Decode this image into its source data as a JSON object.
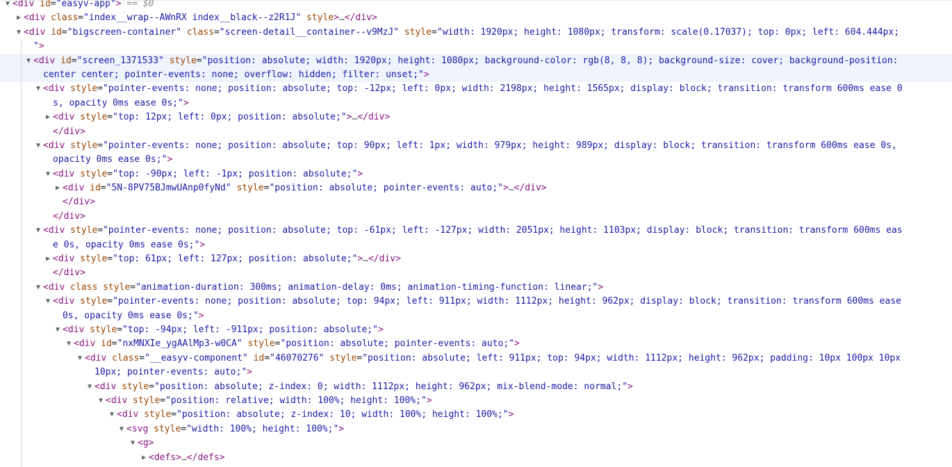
{
  "rows": [
    {
      "name": "row-easyv-app",
      "indent": 4,
      "tri": "▼",
      "html": "<span class='tag'>&lt;div</span> <span class='attr'>id</span><span class='punc'>=</span><span class='val'>\"easyv-app\"</span><span class='tag'>&gt;</span> <span class='eq0'>== $0</span>"
    },
    {
      "name": "row-index-wrap",
      "indent": 20,
      "tri": "▶",
      "html": "<span class='tag'>&lt;div</span> <span class='attr'>class</span><span class='punc'>=</span><span class='val'>\"index__wrap--AWnRX index__black--z2R1J\"</span> <span class='attr'>style</span><span class='tag'>&gt;</span><span class='ellipsis'>…</span><span class='tag'>&lt;/div&gt;</span>"
    },
    {
      "name": "row-bigscreen-container",
      "indent": 20,
      "tri": "▼",
      "html": "<span class='tag'>&lt;div</span> <span class='attr'>id</span><span class='punc'>=</span><span class='val'>\"bigscreen-container\"</span> <span class='attr'>class</span><span class='punc'>=</span><span class='val'>\"screen-detail__container--v9MzJ\"</span> <span class='attr'>style</span><span class='punc'>=</span><span class='val'>\"width: 1920px; height: 1080px; transform: scale(0.17037); top: 0px; left: 604.444px;</span>"
    },
    {
      "name": "row-bigscreen-container-cont",
      "indent": 34,
      "tri": "",
      "html": "<span class='val'>\"</span><span class='tag'>&gt;</span>"
    },
    {
      "name": "row-screen-1371533",
      "indent": 34,
      "tri": "▼",
      "selected": true,
      "html": "<span class='tag'>&lt;div</span> <span class='attr'>id</span><span class='punc'>=</span><span class='val'>\"screen_1371533\"</span> <span class='attr'>style</span><span class='punc'>=</span><span class='val'>\"position: absolute; width: 1920px; height: 1080px; background-color: rgb(8, 8, 8); background-size: cover; background-position:</span>"
    },
    {
      "name": "row-screen-1371533-cont",
      "indent": 48,
      "tri": "",
      "selected": true,
      "html": "<span class='val'>center center; pointer-events: none; overflow: hidden; filter: unset;\"</span><span class='tag'>&gt;</span>"
    },
    {
      "name": "row-layer-1",
      "indent": 48,
      "tri": "▼",
      "html": "<span class='tag'>&lt;div</span> <span class='attr'>style</span><span class='punc'>=</span><span class='val'>\"pointer-events: none; position: absolute; top: -12px; left: 0px; width: 2198px; height: 1565px; display: block; transition: transform 600ms ease 0</span>"
    },
    {
      "name": "row-layer-1-cont",
      "indent": 62,
      "tri": "",
      "html": "<span class='val'>s, opacity 0ms ease 0s;\"</span><span class='tag'>&gt;</span>"
    },
    {
      "name": "row-layer-1-inner",
      "indent": 62,
      "tri": "▶",
      "html": "<span class='tag'>&lt;div</span> <span class='attr'>style</span><span class='punc'>=</span><span class='val'>\"top: 12px; left: 0px; position: absolute;\"</span><span class='tag'>&gt;</span><span class='ellipsis'>…</span><span class='tag'>&lt;/div&gt;</span>"
    },
    {
      "name": "row-layer-1-close",
      "indent": 62,
      "tri": "",
      "html": "<span class='tag'>&lt;/div&gt;</span>"
    },
    {
      "name": "row-layer-2",
      "indent": 48,
      "tri": "▼",
      "html": "<span class='tag'>&lt;div</span> <span class='attr'>style</span><span class='punc'>=</span><span class='val'>\"pointer-events: none; position: absolute; top: 90px; left: 1px; width: 979px; height: 989px; display: block; transition: transform 600ms ease 0s,</span>"
    },
    {
      "name": "row-layer-2-cont",
      "indent": 62,
      "tri": "",
      "html": "<span class='val'>opacity 0ms ease 0s;\"</span><span class='tag'>&gt;</span>"
    },
    {
      "name": "row-layer-2-inner",
      "indent": 62,
      "tri": "▼",
      "html": "<span class='tag'>&lt;div</span> <span class='attr'>style</span><span class='punc'>=</span><span class='val'>\"top: -90px; left: -1px; position: absolute;\"</span><span class='tag'>&gt;</span>"
    },
    {
      "name": "row-layer-2-component",
      "indent": 76,
      "tri": "▶",
      "html": "<span class='tag'>&lt;div</span> <span class='attr'>id</span><span class='punc'>=</span><span class='val'>\"5N-8PV75BJmwUAnp0fyNd\"</span> <span class='attr'>style</span><span class='punc'>=</span><span class='val'>\"position: absolute; pointer-events: auto;\"</span><span class='tag'>&gt;</span><span class='ellipsis'>…</span><span class='tag'>&lt;/div&gt;</span>"
    },
    {
      "name": "row-layer-2-inner-close",
      "indent": 76,
      "tri": "",
      "html": "<span class='tag'>&lt;/div&gt;</span>"
    },
    {
      "name": "row-layer-2-close",
      "indent": 62,
      "tri": "",
      "html": "<span class='tag'>&lt;/div&gt;</span>"
    },
    {
      "name": "row-layer-3",
      "indent": 48,
      "tri": "▼",
      "html": "<span class='tag'>&lt;div</span> <span class='attr'>style</span><span class='punc'>=</span><span class='val'>\"pointer-events: none; position: absolute; top: -61px; left: -127px; width: 2051px; height: 1103px; display: block; transition: transform 600ms eas</span>"
    },
    {
      "name": "row-layer-3-cont",
      "indent": 62,
      "tri": "",
      "html": "<span class='val'>e 0s, opacity 0ms ease 0s;\"</span><span class='tag'>&gt;</span>"
    },
    {
      "name": "row-layer-3-inner",
      "indent": 62,
      "tri": "▶",
      "html": "<span class='tag'>&lt;div</span> <span class='attr'>style</span><span class='punc'>=</span><span class='val'>\"top: 61px; left: 127px; position: absolute;\"</span><span class='tag'>&gt;</span><span class='ellipsis'>…</span><span class='tag'>&lt;/div&gt;</span>"
    },
    {
      "name": "row-layer-3-close",
      "indent": 62,
      "tri": "",
      "html": "<span class='tag'>&lt;/div&gt;</span>"
    },
    {
      "name": "row-animation-div",
      "indent": 48,
      "tri": "▼",
      "html": "<span class='tag'>&lt;div</span> <span class='attr'>class</span> <span class='attr'>style</span><span class='punc'>=</span><span class='val'>\"animation-duration: 300ms; animation-delay: 0ms; animation-timing-function: linear;\"</span><span class='tag'>&gt;</span>"
    },
    {
      "name": "row-layer-4",
      "indent": 62,
      "tri": "▼",
      "html": "<span class='tag'>&lt;div</span> <span class='attr'>style</span><span class='punc'>=</span><span class='val'>\"pointer-events: none; position: absolute; top: 94px; left: 911px; width: 1112px; height: 962px; display: block; transition: transform 600ms ease</span>"
    },
    {
      "name": "row-layer-4-cont",
      "indent": 76,
      "tri": "",
      "html": "<span class='val'>0s, opacity 0ms ease 0s;\"</span><span class='tag'>&gt;</span>"
    },
    {
      "name": "row-layer-4-inner",
      "indent": 76,
      "tri": "▼",
      "html": "<span class='tag'>&lt;div</span> <span class='attr'>style</span><span class='punc'>=</span><span class='val'>\"top: -94px; left: -911px; position: absolute;\"</span><span class='tag'>&gt;</span>"
    },
    {
      "name": "row-layer-4-component",
      "indent": 92,
      "tri": "▼",
      "html": "<span class='tag'>&lt;div</span> <span class='attr'>id</span><span class='punc'>=</span><span class='val'>\"nxMNXIe_ygAAlMp3-w0CA\"</span> <span class='attr'>style</span><span class='punc'>=</span><span class='val'>\"position: absolute; pointer-events: auto;\"</span><span class='tag'>&gt;</span>"
    },
    {
      "name": "row-easyv-component",
      "indent": 108,
      "tri": "▼",
      "html": "<span class='tag'>&lt;div</span> <span class='attr'>class</span><span class='punc'>=</span><span class='val'>\"__easyv-component\"</span> <span class='attr'>id</span><span class='punc'>=</span><span class='val'>\"46070276\"</span> <span class='attr'>style</span><span class='punc'>=</span><span class='val'>\"position: absolute; left: 911px; top: 94px; width: 1112px; height: 962px; padding: 10px 100px 10px</span>"
    },
    {
      "name": "row-easyv-component-cont",
      "indent": 122,
      "tri": "",
      "html": "<span class='val'>10px; pointer-events: auto;\"</span><span class='tag'>&gt;</span>"
    },
    {
      "name": "row-blend-div",
      "indent": 122,
      "tri": "▼",
      "html": "<span class='tag'>&lt;div</span> <span class='attr'>style</span><span class='punc'>=</span><span class='val'>\"position: absolute; z-index: 0; width: 1112px; height: 962px; mix-blend-mode: normal;\"</span><span class='tag'>&gt;</span>"
    },
    {
      "name": "row-relative-div",
      "indent": 138,
      "tri": "▼",
      "html": "<span class='tag'>&lt;div</span> <span class='attr'>style</span><span class='punc'>=</span><span class='val'>\"position: relative; width: 100%; height: 100%;\"</span><span class='tag'>&gt;</span>"
    },
    {
      "name": "row-zindex-div",
      "indent": 154,
      "tri": "▼",
      "html": "<span class='tag'>&lt;div</span> <span class='attr'>style</span><span class='punc'>=</span><span class='val'>\"position: absolute; z-index: 10; width: 100%; height: 100%;\"</span><span class='tag'>&gt;</span>"
    },
    {
      "name": "row-svg",
      "indent": 168,
      "tri": "▼",
      "html": "<span class='tag'>&lt;svg</span> <span class='attr'>style</span><span class='punc'>=</span><span class='val'>\"width: 100%; height: 100%;\"</span><span class='tag'>&gt;</span>"
    },
    {
      "name": "row-g",
      "indent": 184,
      "tri": "▼",
      "html": "<span class='tag'>&lt;g&gt;</span>"
    },
    {
      "name": "row-defs",
      "indent": 200,
      "tri": "▶",
      "html": "<span class='tag'>&lt;defs&gt;</span><span class='ellipsis'>…</span><span class='tag'>&lt;/defs&gt;</span>"
    }
  ]
}
